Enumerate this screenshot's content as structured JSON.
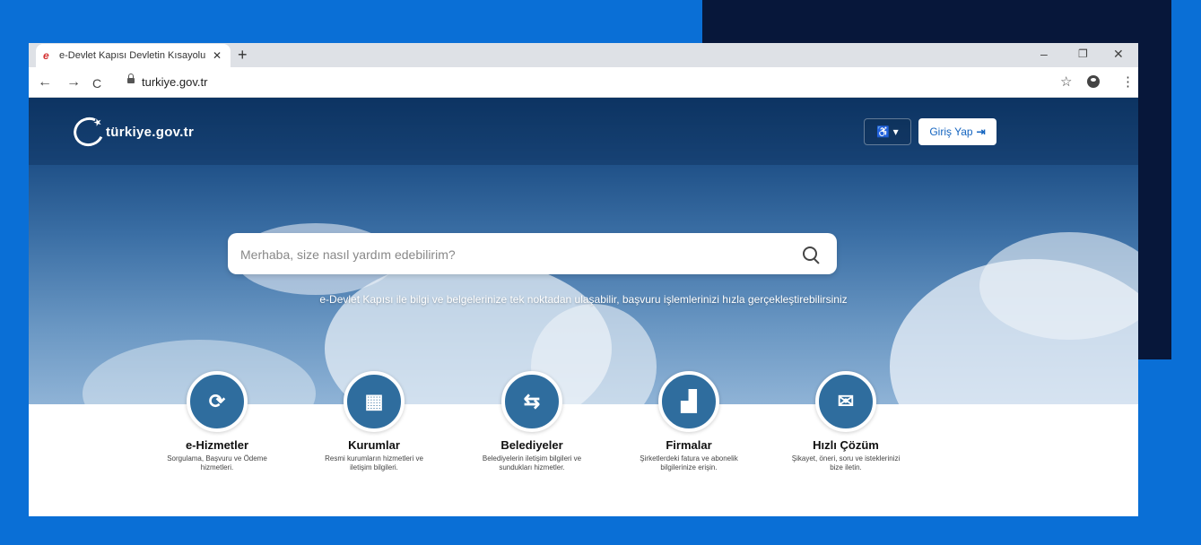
{
  "browser": {
    "tab_title": "e-Devlet Kapısı Devletin Kısayolu",
    "tab_close": "✕",
    "new_tab": "+",
    "url": "turkiye.gov.tr",
    "back": "←",
    "forward": "→",
    "reload": "C",
    "bookmark": "☆",
    "menu": "⋮",
    "minimize": "–",
    "restore": "❐",
    "close": "✕"
  },
  "header": {
    "logo_text": "türkiye.gov.tr",
    "accessibility": "♿ ▾",
    "login_label": "Giriş Yap",
    "login_arrow": "⇥"
  },
  "search": {
    "placeholder": "Merhaba, size nasıl yardım edebilirim?"
  },
  "tagline": "e-Devlet Kapısı ile bilgi ve belgelerinize tek noktadan ulaşabilir, başvuru işlemlerinizi hızla gerçekleştirebilirsiniz",
  "services": [
    {
      "title": "e-Hizmetler",
      "desc": "Sorgulama, Başvuru ve Ödeme hizmetleri.",
      "glyph": "⟳",
      "icon": "refresh-icon"
    },
    {
      "title": "Kurumlar",
      "desc": "Resmi kurumların hizmetleri ve iletişim bilgileri.",
      "glyph": "▦",
      "icon": "building-icon"
    },
    {
      "title": "Belediyeler",
      "desc": "Belediyelerin iletişim bilgileri ve sundukları hizmetler.",
      "glyph": "⇆",
      "icon": "signpost-icon"
    },
    {
      "title": "Firmalar",
      "desc": "Şirketlerdeki fatura ve abonelik bilgilerinize erişin.",
      "glyph": "▟",
      "icon": "factory-icon"
    },
    {
      "title": "Hızlı Çözüm",
      "desc": "Şikayet, öneri, soru ve isteklerinizi bize iletin.",
      "glyph": "✉",
      "icon": "chat-icon"
    }
  ]
}
